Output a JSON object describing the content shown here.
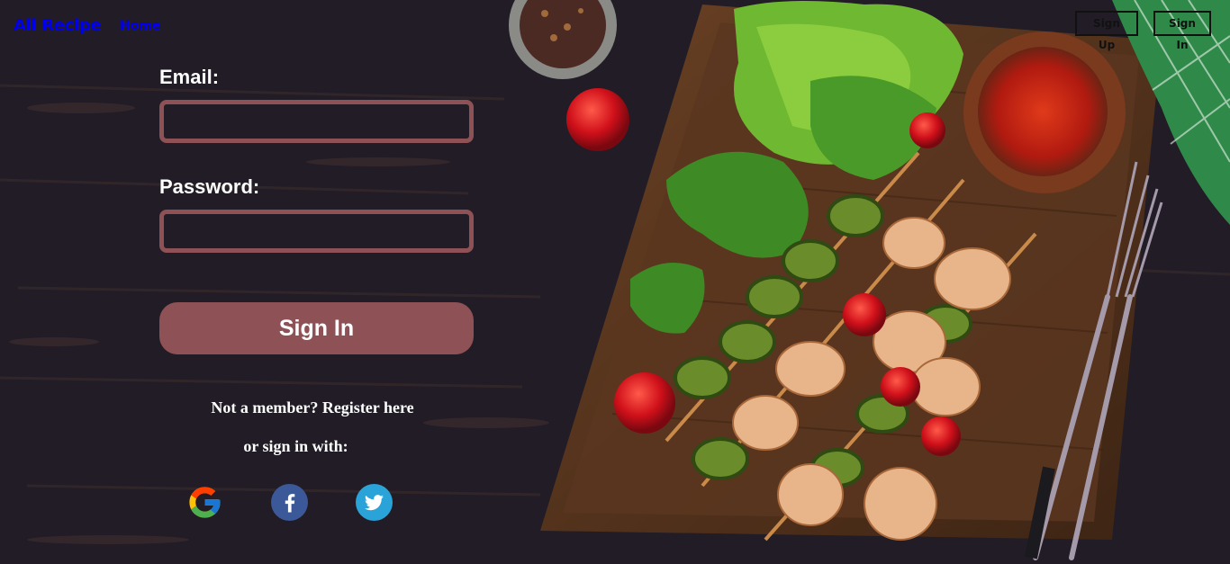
{
  "nav": {
    "brand": "All Recipe",
    "home": "Home",
    "sign_up": "Sign Up",
    "sign_in": "Sign In"
  },
  "form": {
    "email_label": "Email:",
    "email_value": "",
    "password_label": "Password:",
    "password_value": "",
    "submit_label": "Sign In",
    "register_text": "Not a member? Register here",
    "social_text": "or sign in with:"
  },
  "social": [
    {
      "icon": "google-icon"
    },
    {
      "icon": "facebook-icon"
    },
    {
      "icon": "twitter-icon"
    }
  ],
  "colors": {
    "background": "#211c25",
    "accent": "#8e5155",
    "link": "#0000ee",
    "facebook": "#3b5998",
    "twitter": "#2aa3d8"
  }
}
